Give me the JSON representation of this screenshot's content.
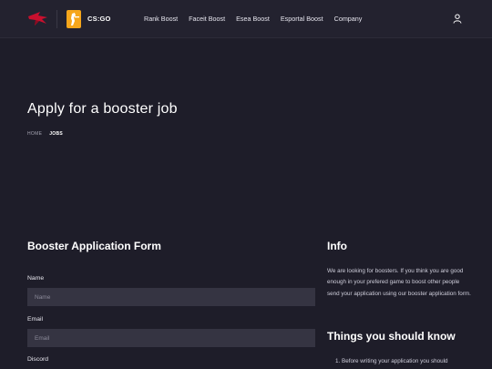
{
  "header": {
    "game_label": "CS:GO",
    "nav": [
      "Rank Boost",
      "Faceit Boost",
      "Esea Boost",
      "Esportal Boost",
      "Company"
    ],
    "brand_color": "#c8102e",
    "game_color": "#f6a61b",
    "icons": {
      "logo": "bird-logo-icon",
      "game": "csgo-icon",
      "user": "user-icon"
    }
  },
  "hero": {
    "title": "Apply for a booster job",
    "breadcrumb": {
      "home": "HOME",
      "current": "JOBS"
    }
  },
  "form": {
    "title": "Booster Application Form",
    "fields": [
      {
        "label": "Name",
        "placeholder": "Name"
      },
      {
        "label": "Email",
        "placeholder": "Email"
      },
      {
        "label": "Discord"
      }
    ]
  },
  "sidebar": {
    "info_title": "Info",
    "info_text": "We are looking for boosters. If you think you are good enough in your prefered game to boost other people send your application using our booster application form.",
    "things_title": "Things you should know",
    "things": [
      "1.  Before writing your application you should"
    ]
  }
}
